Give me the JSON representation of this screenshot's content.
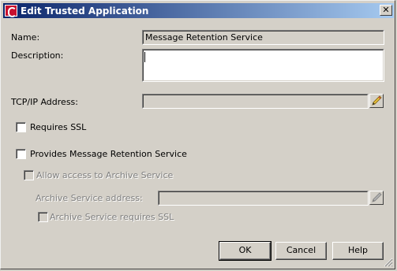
{
  "window": {
    "title": "Edit Trusted Application",
    "close_glyph": "✕"
  },
  "form": {
    "name_label": "Name:",
    "name_value": "Message Retention Service",
    "description_label": "Description:",
    "description_value": "",
    "tcpip_label": "TCP/IP Address:",
    "tcpip_value": "",
    "requires_ssl_label": "Requires SSL",
    "requires_ssl_checked": false,
    "provides_mrs_label": "Provides Message Retention Service",
    "provides_mrs_checked": false,
    "allow_archive_label": "Allow access to Archive Service",
    "allow_archive_checked": false,
    "archive_address_label": "Archive Service address:",
    "archive_address_value": "",
    "archive_ssl_label": "Archive Service requires SSL",
    "archive_ssl_checked": false
  },
  "buttons": {
    "ok": "OK",
    "cancel": "Cancel",
    "help": "Help"
  },
  "icons": {
    "app": "app-logo-icon",
    "edit": "pencil-icon",
    "close": "close-icon",
    "resize": "resize-grip-icon"
  },
  "colors": {
    "title_start": "#0a246a",
    "title_end": "#a6caf0",
    "face": "#d4d0c8",
    "app_icon": "#c8102e"
  }
}
